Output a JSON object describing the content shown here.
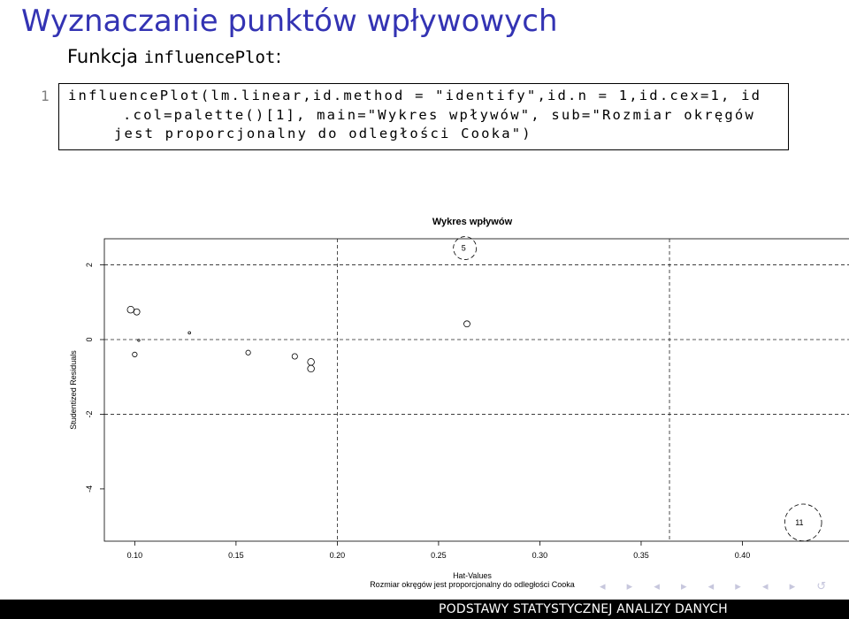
{
  "slide": {
    "title": "Wyznaczanie punktów wpływowych",
    "subtitle_prefix": "Funkcja ",
    "subtitle_code": "influencePlot",
    "subtitle_suffix": ":"
  },
  "code": {
    "line_number": "1",
    "lines": [
      "influencePlot(lm.linear,id.method = \"identify\",id.n = 1,id.cex=1, id",
      ".col=palette()[1], main=\"Wykres wpływów\", sub=\"Rozmiar okręgów",
      "jest proporcjonalny do odległości Cooka\")"
    ]
  },
  "chart_data": {
    "type": "scatter",
    "title": "Wykres wpływów",
    "xlabel": "Hat-Values",
    "ylabel": "Studentized Residuals",
    "sub": "Rozmiar okręgów jest proporcjonalny do odległości Cooka",
    "xlim": [
      0.085,
      0.45
    ],
    "ylim": [
      -5.4,
      2.7
    ],
    "x_ticks": [
      0.1,
      0.15,
      0.2,
      0.25,
      0.3,
      0.35,
      0.4
    ],
    "x_tick_labels": [
      "0.10",
      "0.15",
      "0.20",
      "0.25",
      "0.30",
      "0.35",
      "0.40"
    ],
    "y_ticks": [
      2,
      0,
      -2,
      -4
    ],
    "y_tick_labels": [
      "2",
      "0",
      "-2",
      "-4"
    ],
    "hlines": [
      2,
      0,
      -2
    ],
    "vlines": [
      0.2,
      0.364
    ],
    "points": [
      {
        "x": 0.098,
        "y": 0.8,
        "cook": 0.03,
        "label": ""
      },
      {
        "x": 0.101,
        "y": 0.74,
        "cook": 0.025,
        "label": ""
      },
      {
        "x": 0.1,
        "y": -0.4,
        "cook": 0.015,
        "label": ""
      },
      {
        "x": 0.102,
        "y": -0.02,
        "cook": 0.003,
        "label": ""
      },
      {
        "x": 0.127,
        "y": 0.18,
        "cook": 0.004,
        "label": ""
      },
      {
        "x": 0.156,
        "y": -0.35,
        "cook": 0.015,
        "label": ""
      },
      {
        "x": 0.179,
        "y": -0.45,
        "cook": 0.02,
        "label": ""
      },
      {
        "x": 0.187,
        "y": -0.6,
        "cook": 0.03,
        "label": ""
      },
      {
        "x": 0.187,
        "y": -0.78,
        "cook": 0.03,
        "label": ""
      },
      {
        "x": 0.264,
        "y": 0.42,
        "cook": 0.025,
        "label": ""
      },
      {
        "x": 0.263,
        "y": 2.45,
        "cook": 0.35,
        "label": "5"
      },
      {
        "x": 0.43,
        "y": -4.9,
        "cook": 0.9,
        "label": "11"
      }
    ],
    "grid": false
  },
  "footer": {
    "right_text": "PODSTAWY STATYSTYCZNEJ ANALIZY DANYCH"
  }
}
